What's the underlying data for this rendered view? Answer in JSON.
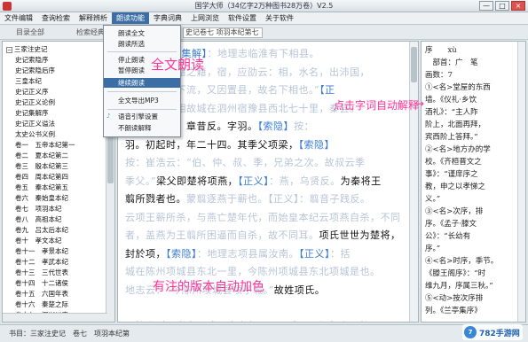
{
  "window": {
    "title": "国学大师（34亿字2万种图书28万卷）V2.5",
    "controls": [
      "—",
      "□",
      "×"
    ]
  },
  "menubar": {
    "items": [
      "文件编辑",
      "查询检索",
      "解释辨析",
      "朗读功能",
      "字典词典",
      "上网浏览",
      "软件设置",
      "关于软件"
    ],
    "active_index": 3
  },
  "toolbar": {
    "catalog_label": "目录全部",
    "search_label": "检索经典",
    "book_field": "史记卷七 项羽本纪第七"
  },
  "dropdown": {
    "items": [
      {
        "label": "朗读全文",
        "highlight": false
      },
      {
        "label": "朗读所选",
        "highlight": false
      },
      {
        "label": "停止朗读",
        "highlight": false
      },
      {
        "label": "暂停朗读",
        "highlight": false
      },
      {
        "label": "继续朗读",
        "highlight": true
      },
      {
        "label": "全文导出MP3",
        "highlight": false
      },
      {
        "label": "语音引擎设置",
        "highlight": false
      },
      {
        "label": "不朗读解释",
        "highlight": false
      }
    ]
  },
  "tree": {
    "nodes": [
      {
        "label": "三家注史记",
        "level": 1,
        "toggle": "−"
      },
      {
        "label": "史记索隐序",
        "level": 2
      },
      {
        "label": "史记索隐后序",
        "level": 2
      },
      {
        "label": "三皇本纪",
        "level": 2
      },
      {
        "label": "史记正义序",
        "level": 2
      },
      {
        "label": "史记正义论例",
        "level": 2
      },
      {
        "label": "史记集解序",
        "level": 2
      },
      {
        "label": "史记正义谥法",
        "level": 2
      },
      {
        "label": "太史公书义例",
        "level": 2
      },
      {
        "label": "卷一　五帝本纪第一",
        "level": 2
      },
      {
        "label": "卷二　夏本纪第二",
        "level": 2
      },
      {
        "label": "卷三　殷本纪第三",
        "level": 2
      },
      {
        "label": "卷四　周本纪第四",
        "level": 2
      },
      {
        "label": "卷五　秦本纪第五",
        "level": 2
      },
      {
        "label": "卷六　秦始皇本纪",
        "level": 2
      },
      {
        "label": "卷七　项羽本纪",
        "level": 2
      },
      {
        "label": "卷八　高祖本纪",
        "level": 2
      },
      {
        "label": "卷九　吕太后本纪",
        "level": 2
      },
      {
        "label": "卷十　孝文本纪",
        "level": 2
      },
      {
        "label": "卷十一　孝景本纪",
        "level": 2
      },
      {
        "label": "卷十二　孝武本纪",
        "level": 2
      },
      {
        "label": "卷十三　三代世表",
        "level": 2
      },
      {
        "label": "卷十四　十二诸侯",
        "level": 2
      },
      {
        "label": "卷十五　六国年表",
        "level": 2
      },
      {
        "label": "卷十六　秦楚之际",
        "level": 2
      },
      {
        "label": "卷十七　汉兴以来",
        "level": 2
      },
      {
        "label": "卷十八　高祖功臣",
        "level": 2
      },
      {
        "label": "卷十九　惠景间侯",
        "level": 2
      }
    ]
  },
  "main_text": {
    "lines": [
      {
        "segments": [
          {
            "t": "下相人也，",
            "c": "n"
          },
          {
            "t": "【集解】",
            "c": "a"
          },
          {
            "t": "：地理志临淮有下相县。",
            "c": "f"
          }
        ]
      },
      {
        "segments": [
          {
            "t": "籍之字，若籍之籍，宿，应劭云：相，水名，出沛国，",
            "c": "f"
          }
        ]
      },
      {
        "segments": [
          {
            "t": "故城，其水下流，又因置县，故名下相也。”",
            "c": "f"
          },
          {
            "t": "【正",
            "c": "a"
          }
        ]
      },
      {
        "segments": [
          {
            "t": "括地志云：相故城在泗州宿豫县西北七十里，秦县。",
            "c": "f"
          }
        ]
      },
      {
        "segments": [
          {
            "t": "持讲反，籍，章昔反。字羽。",
            "c": "n"
          },
          {
            "t": "【索隐】",
            "c": "a"
          },
          {
            "t": "按：",
            "c": "f"
          }
        ]
      },
      {
        "segments": [
          {
            "t": "羽。初起时，年二十四。其季父项梁，",
            "c": "n"
          },
          {
            "t": "【索隐】",
            "c": "a"
          }
        ]
      },
      {
        "segments": [
          {
            "t": "按：崔浩云：“伯、仲、叔、季，兄弟之次。故叔云季",
            "c": "f"
          }
        ]
      },
      {
        "segments": [
          {
            "t": "季父。”",
            "c": "f"
          },
          {
            "t": "梁父即楚将项燕，",
            "c": "n"
          },
          {
            "t": "【正义】",
            "c": "a"
          },
          {
            "t": "：燕，乌贤反。",
            "c": "f"
          },
          {
            "t": "为秦将王",
            "c": "n"
          }
        ]
      },
      {
        "segments": [
          {
            "t": "翦所戮者也。",
            "c": "n"
          },
          {
            "t": "蒙翦逐燕于蕲也。【正义】：翦音子践反。",
            "c": "f"
          }
        ]
      },
      {
        "segments": [
          {
            "t": "云项王蕲所杀，与燕亡楚年代，而始皇本纪云项燕自杀，不同",
            "c": "f"
          }
        ]
      },
      {
        "segments": [
          {
            "t": "者，盖燕为王翦所困逼而自杀，故不同耳。",
            "c": "f"
          },
          {
            "t": "项氏世世为楚将，",
            "c": "n"
          }
        ]
      },
      {
        "segments": [
          {
            "t": "封於项，",
            "c": "n"
          },
          {
            "t": "【索隐】",
            "c": "a"
          },
          {
            "t": "：地理志项县属汝南。",
            "c": "f"
          },
          {
            "t": "【正义】",
            "c": "a"
          },
          {
            "t": "：括",
            "c": "f"
          }
        ]
      },
      {
        "segments": [
          {
            "t": "城在陈州项城县东北一里，今陈州项城县东北项城是也。",
            "c": "f"
          }
        ]
      },
      {
        "segments": [
          {
            "t": "地志云：“今陈州项城县项子城。”",
            "c": "f"
          },
          {
            "t": "故姓项氏。",
            "c": "n"
          }
        ]
      },
      {
        "segments": [
          {
            "t": " ",
            "c": "n"
          }
        ]
      },
      {
        "segments": [
          {
            "t": "项籍少时，学书不成，去学剑，又不成。项梁怒之。籍",
            "c": "n"
          }
        ]
      }
    ]
  },
  "right_text": {
    "lines": [
      "序　　xù",
      "　部首：广　笔",
      "画数：7",
      "①<名>堂屋的东西",
      "墙。《仪礼·乡饮",
      "酒礼》：“主人阼",
      "阶上，北面再拜，",
      "宾西阶上答拜。”",
      "②<名>地方办的学",
      "校。《齐桓晋文之",
      "事》：“谨庠序之",
      "教，申之以孝悌之",
      "义。”",
      "③<名>次序，排",
      "序。《孟子·滕文",
      "公》：“长幼有",
      "序。”",
      "④<名>时序，季节。",
      "《滕王阁序》：“时",
      "维九月，序属三秋。”",
      "⑤<动>按次序排",
      "列。《兰亭集序》",
      "......"
    ]
  },
  "overlays": {
    "full_text_read": "全文朗读",
    "dictionary_click": "点击字词自动解释",
    "annotated_color": "有注的版本自动加色",
    "arrow": "→"
  },
  "status": {
    "text": "书目：三家注史记　卷七　项羽本纪第",
    "watermark": "782手游网"
  },
  "colors": {
    "annotation": "#3a7bd5",
    "faded": "#b7c4d6",
    "overlay": "#ff3399",
    "menu_highlight": "#3a6ea5"
  }
}
